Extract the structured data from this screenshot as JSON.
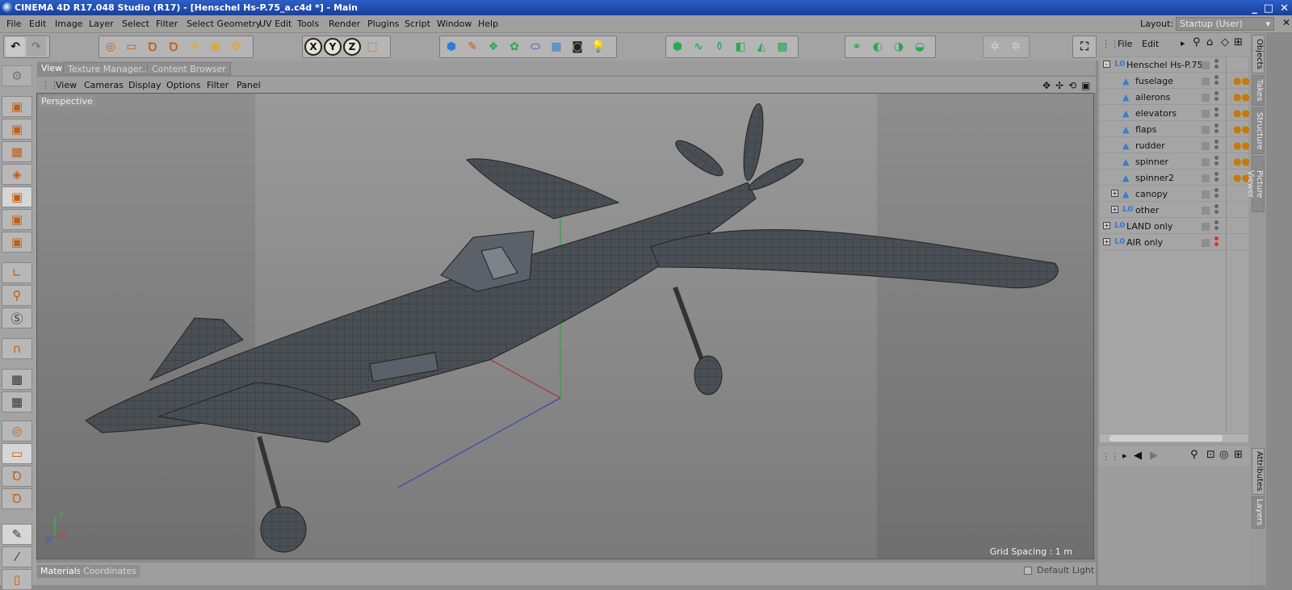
{
  "window": {
    "title": "CINEMA 4D R17.048 Studio (R17) - [Henschel Hs-P.75_a.c4d *] - Main",
    "controls": [
      "_",
      "□",
      "✕"
    ]
  },
  "menu": [
    "File",
    "Edit",
    "Image",
    "Layer",
    "Select",
    "Filter",
    "Select Geometry",
    "UV Edit",
    "Tools",
    "Render",
    "Plugins",
    "Script",
    "Window",
    "Help"
  ],
  "layout": {
    "label": "Layout:",
    "value": "Startup (User)"
  },
  "toolbar": {
    "axis_labels": [
      "X",
      "Y",
      "Z"
    ]
  },
  "view_tabs": [
    "View",
    "Texture Manager...",
    "Content Browser"
  ],
  "view_menu": [
    "View",
    "Cameras",
    "Display",
    "Options",
    "Filter",
    "Panel"
  ],
  "viewport": {
    "label": "Perspective",
    "grid_spacing": "Grid Spacing : 1 m",
    "axis": [
      "Y",
      "X",
      "Z"
    ]
  },
  "bottom_tabs": [
    "Materials",
    "Coordinates"
  ],
  "default_light": "Default Light",
  "object_manager": {
    "menu": [
      "File",
      "Edit"
    ],
    "objects": [
      {
        "name": "Henschel Hs-P.75",
        "level": 0,
        "type": "null",
        "expand": "-"
      },
      {
        "name": "fuselage",
        "level": 1,
        "type": "poly"
      },
      {
        "name": "ailerons",
        "level": 1,
        "type": "poly"
      },
      {
        "name": "elevators",
        "level": 1,
        "type": "poly"
      },
      {
        "name": "flaps",
        "level": 1,
        "type": "poly"
      },
      {
        "name": "rudder",
        "level": 1,
        "type": "poly"
      },
      {
        "name": "spinner",
        "level": 1,
        "type": "poly"
      },
      {
        "name": "spinner2",
        "level": 1,
        "type": "poly"
      },
      {
        "name": "canopy",
        "level": 1,
        "type": "poly",
        "expand": "+"
      },
      {
        "name": "other",
        "level": 1,
        "type": "null",
        "expand": "+"
      },
      {
        "name": "LAND only",
        "level": 0,
        "type": "null",
        "expand": "+"
      },
      {
        "name": "AIR only",
        "level": 0,
        "type": "null",
        "expand": "+"
      }
    ]
  },
  "right_tabs": [
    "Objects",
    "Takes",
    "Structure",
    "Picture Viewer"
  ],
  "right_tabs_bottom": [
    "Attributes",
    "Layers"
  ],
  "colors": {
    "accent_orange": "#c45d10",
    "axis_x": "#c0392b",
    "axis_y": "#2e9e3e",
    "axis_z": "#2b3fb8"
  }
}
